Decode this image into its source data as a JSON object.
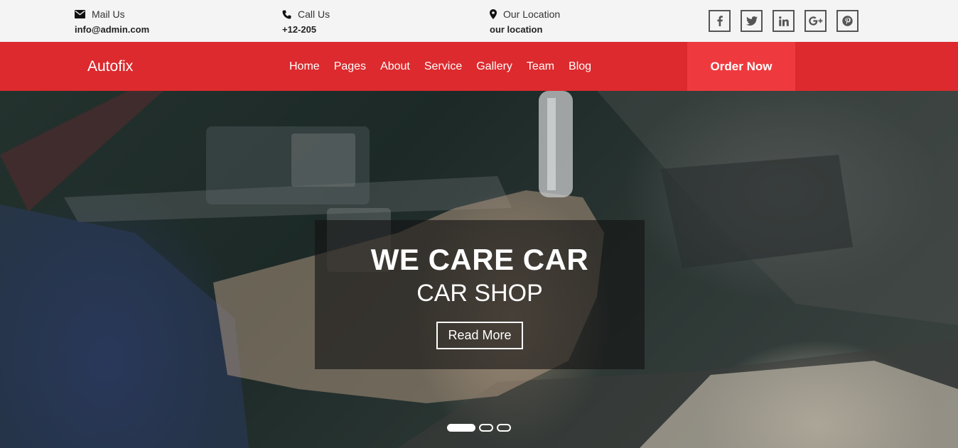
{
  "topbar": {
    "mail": {
      "icon": "envelope-icon",
      "label": "Mail Us",
      "value": "info@admin.com"
    },
    "call": {
      "icon": "phone-icon",
      "label": "Call Us",
      "value": "+12-205"
    },
    "location": {
      "icon": "map-marker-icon",
      "label": "Our Location",
      "value": "our location"
    },
    "socials": [
      "facebook-icon",
      "twitter-icon",
      "linkedin-icon",
      "google-plus-icon",
      "pinterest-icon"
    ]
  },
  "nav": {
    "brand": "Autofix",
    "items": [
      "Home",
      "Pages",
      "About",
      "Service",
      "Gallery",
      "Team",
      "Blog"
    ],
    "order_label": "Order Now"
  },
  "hero": {
    "title": "WE CARE CAR",
    "subtitle": "CAR SHOP",
    "button_label": "Read More",
    "slides_count": 3,
    "active_slide": 1
  },
  "colors": {
    "nav_bg": "#dc2a2e",
    "order_bg": "#ee3a3e",
    "topbar_bg": "#f4f4f4"
  }
}
